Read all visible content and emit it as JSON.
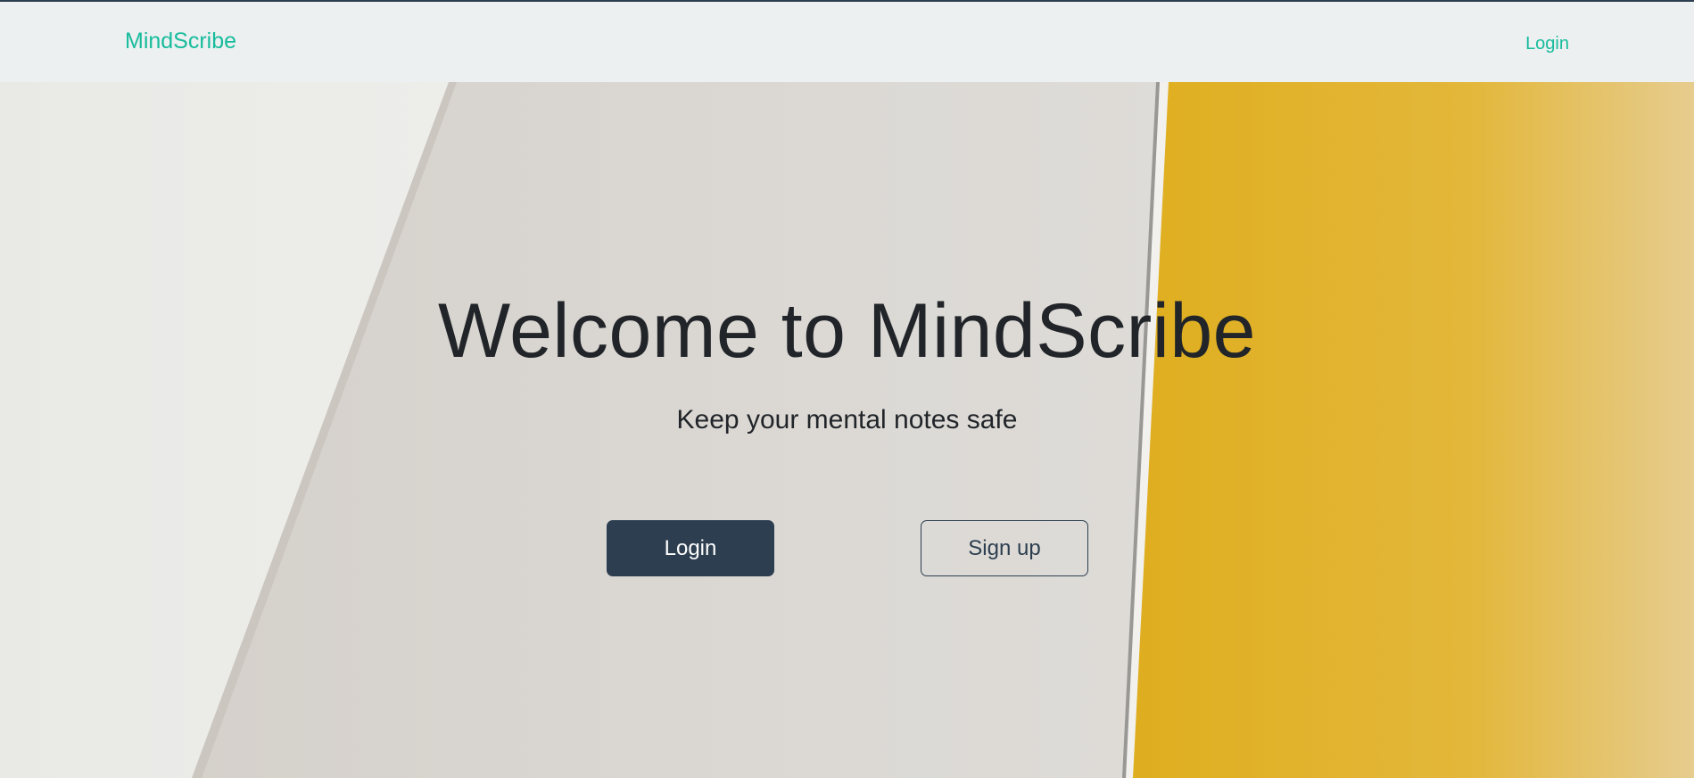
{
  "navbar": {
    "brand": "MindScribe",
    "login_label": "Login"
  },
  "hero": {
    "title": "Welcome to MindScribe",
    "subtitle": "Keep your mental notes safe",
    "login_button": "Login",
    "signup_button": "Sign up"
  },
  "colors": {
    "brand_accent": "#18bc9c",
    "primary_button": "#2c3e50",
    "navbar_bg": "#ecf0f1",
    "text_dark": "#212529",
    "paper_yellow": "#e2b42a"
  }
}
